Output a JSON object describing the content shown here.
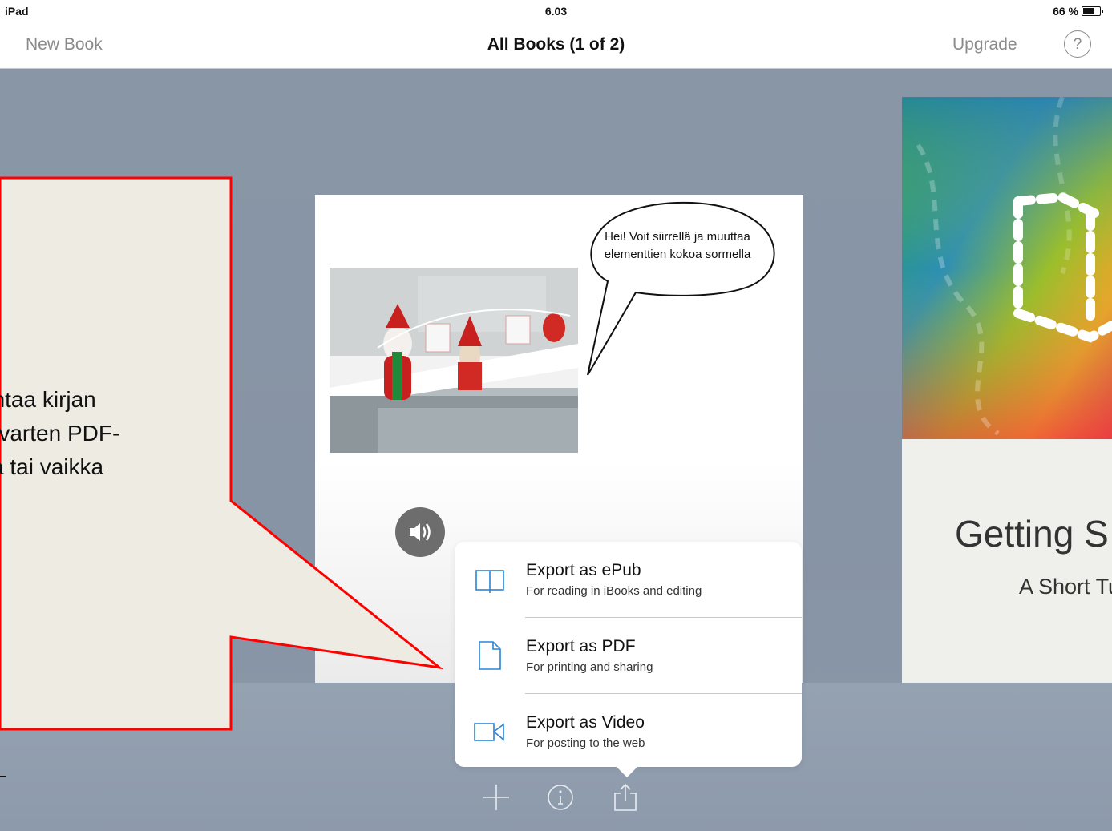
{
  "status_bar": {
    "device": "iPad",
    "time": "6.03",
    "battery": "66 %"
  },
  "nav": {
    "new_book": "New Book",
    "title": "All Books (1 of 2)",
    "upgrade": "Upgrade",
    "help": "?"
  },
  "book_page": {
    "speech_bubble": "Hei! Voit siirrellä ja muuttaa elementtien kokoa sormella"
  },
  "other_book": {
    "title": "Getting S",
    "subtitle": "A Short Tu"
  },
  "callout": {
    "lines": [
      "entaa kirjan",
      "a varten PDF-",
      "sa tai vaikka"
    ]
  },
  "export_menu": {
    "items": [
      {
        "title": "Export as ePub",
        "subtitle": "For reading in iBooks and editing",
        "icon": "book-icon"
      },
      {
        "title": "Export as PDF",
        "subtitle": "For printing and sharing",
        "icon": "document-icon"
      },
      {
        "title": "Export as Video",
        "subtitle": "For posting to the web",
        "icon": "video-camera-icon"
      }
    ]
  },
  "toolbar": {
    "icons": [
      "plus-icon",
      "info-icon",
      "share-icon"
    ]
  },
  "colors": {
    "background": "#8996a6",
    "callout_fill": "#eeebe2",
    "callout_border": "#ff0000"
  }
}
